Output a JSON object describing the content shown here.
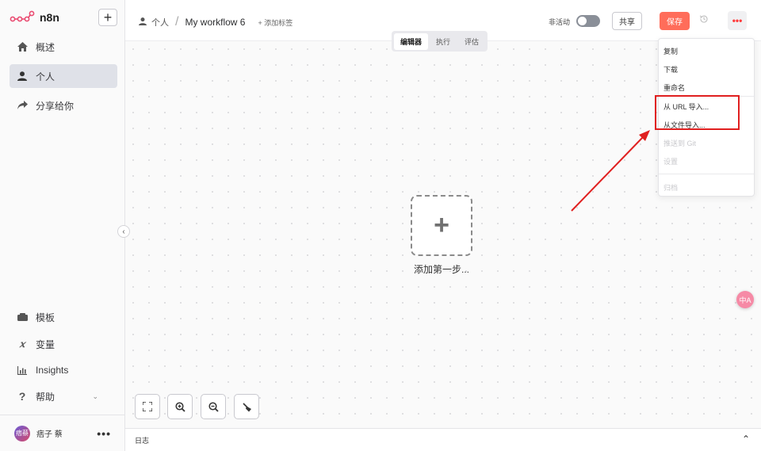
{
  "app": {
    "logo_text": "n8n",
    "new_button": "+"
  },
  "sidebar": {
    "items": [
      {
        "label": "概述",
        "icon": "home-icon"
      },
      {
        "label": "个人",
        "icon": "user-icon",
        "active": true
      },
      {
        "label": "分享给你",
        "icon": "share-icon"
      }
    ],
    "bottom_items": [
      {
        "label": "模板",
        "icon": "template-icon"
      },
      {
        "label": "变量",
        "icon": "variable-icon"
      },
      {
        "label": "Insights",
        "icon": "insights-icon"
      },
      {
        "label": "帮助",
        "icon": "help-icon"
      }
    ],
    "user": {
      "avatar_text": "痞蔡",
      "name": "痞子 蔡"
    }
  },
  "header": {
    "breadcrumb_owner": "个人",
    "breadcrumb_sep": "/",
    "workflow_name": "My workflow 6",
    "add_tag": "+ 添加标签",
    "status_label": "非活动",
    "share": "共享",
    "save": "保存",
    "more": "•••"
  },
  "tabs": [
    {
      "label": "编辑器",
      "active": true
    },
    {
      "label": "执行"
    },
    {
      "label": "评估"
    }
  ],
  "canvas": {
    "add_first_step": "添加第一步..."
  },
  "menu": {
    "items": [
      {
        "label": "复制"
      },
      {
        "label": "下载"
      },
      {
        "label": "重命名"
      },
      {
        "label": "从 URL 导入..."
      },
      {
        "label": "从文件导入..."
      },
      {
        "label": "推送到 Git",
        "disabled": true
      },
      {
        "label": "设置",
        "disabled": true
      },
      {
        "label": "归档",
        "disabled": true
      }
    ]
  },
  "log": {
    "label": "日志"
  },
  "translate_fab": "中A",
  "colors": {
    "accent": "#ff6d5a",
    "annotation": "#e02020"
  }
}
